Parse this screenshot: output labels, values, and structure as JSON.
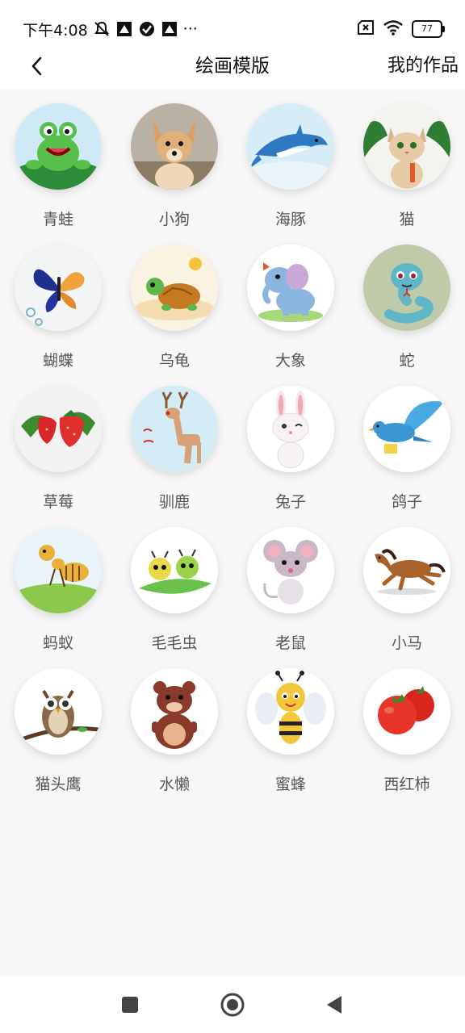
{
  "status_bar": {
    "time": "下午4:08",
    "more": "···",
    "battery": "77",
    "icons": [
      "mute-bell-icon",
      "app-notification-icon",
      "check-circle-icon",
      "app-notification-icon",
      "sim-error-icon",
      "wifi-icon",
      "battery-icon"
    ]
  },
  "header": {
    "back_icon": "chevron-left-icon",
    "title": "绘画模版",
    "action": "我的作品"
  },
  "templates": [
    {
      "label": "青蛙",
      "icon": "frog"
    },
    {
      "label": "小狗",
      "icon": "dog"
    },
    {
      "label": "海豚",
      "icon": "dolphin"
    },
    {
      "label": "猫",
      "icon": "cat"
    },
    {
      "label": "蝴蝶",
      "icon": "butterfly"
    },
    {
      "label": "乌龟",
      "icon": "turtle"
    },
    {
      "label": "大象",
      "icon": "elephant"
    },
    {
      "label": "蛇",
      "icon": "snake"
    },
    {
      "label": "草莓",
      "icon": "strawberry"
    },
    {
      "label": "驯鹿",
      "icon": "reindeer"
    },
    {
      "label": "兔子",
      "icon": "rabbit"
    },
    {
      "label": "鸽子",
      "icon": "pigeon"
    },
    {
      "label": "蚂蚁",
      "icon": "ant"
    },
    {
      "label": "毛毛虫",
      "icon": "caterpillar"
    },
    {
      "label": "老鼠",
      "icon": "mouse"
    },
    {
      "label": "小马",
      "icon": "horse"
    },
    {
      "label": "猫头鹰",
      "icon": "owl"
    },
    {
      "label": "水懒",
      "icon": "otter"
    },
    {
      "label": "蜜蜂",
      "icon": "bee"
    },
    {
      "label": "西红柿",
      "icon": "tomato"
    }
  ],
  "navbar": {
    "icons": [
      "square-recents-icon",
      "circle-home-icon",
      "triangle-back-icon"
    ]
  }
}
